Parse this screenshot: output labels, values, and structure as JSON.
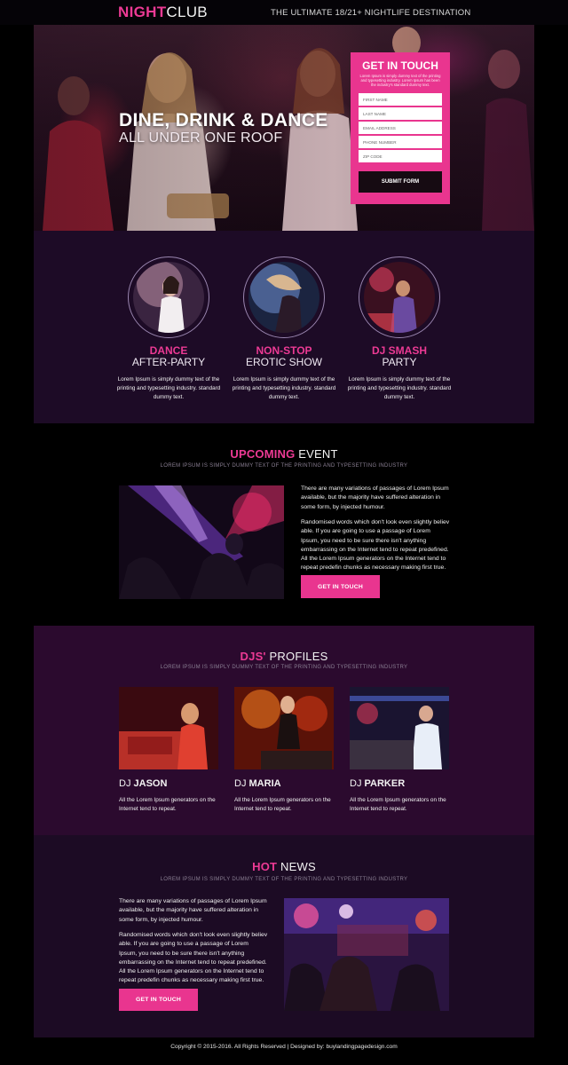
{
  "header": {
    "logo_part1": "NIGHT",
    "logo_part2": "CLUB",
    "tagline": "THE ULTIMATE 18/21+ NIGHTLIFE DESTINATION"
  },
  "hero": {
    "title": "DINE, DRINK & DANCE",
    "subtitle": "ALL UNDER ONE ROOF"
  },
  "form": {
    "title": "GET IN TOUCH",
    "description": "Lorem Ipsum is simply dummy text of the printing and typesetting industry. Lorem Ipsum has been the industry's standard dummy text.",
    "fields": {
      "first_name": "FIRST NAME",
      "last_name": "LAST NAME",
      "email": "EMAIL ADDRESS",
      "phone": "PHONE NUMBER",
      "zip": "ZIP CODE"
    },
    "submit_label": "SUBMIT FORM"
  },
  "features": [
    {
      "title_bold": "DANCE",
      "title_light": "AFTER-PARTY",
      "text": "Lorem Ipsum is simply dummy text of the printing and typesetting industry. standard dummy text."
    },
    {
      "title_bold": "NON-STOP",
      "title_light": "EROTIC SHOW",
      "text": "Lorem Ipsum is simply dummy text of the printing and typesetting industry. standard dummy text."
    },
    {
      "title_bold": "DJ SMASH",
      "title_light": "PARTY",
      "text": "Lorem Ipsum is simply dummy text of the printing and typesetting industry. standard dummy text."
    }
  ],
  "upcoming": {
    "title_highlight": "UPCOMING",
    "title_rest": "EVENT",
    "subtitle": "LOREM IPSUM IS SIMPLY DUMMY TEXT OF THE PRINTING AND TYPESETTING INDUSTRY",
    "para1": "There are many variations of passages of Lorem Ipsum available, but the majority have suffered alteration in some form, by injected humour.",
    "para2": "Randomised words which don't look even slightly believ able. If you are going to use a passage of Lorem Ipsum, you need to be sure there isn't anything embarrassing on the Internet tend to repeat predefined. All the Lorem Ipsum generators on the Internet tend to repeat predefin chunks as necessary making first true.",
    "button_label": "GET IN TOUCH"
  },
  "djs": {
    "title_highlight": "DJS'",
    "title_rest": "PROFILES",
    "subtitle": "LOREM IPSUM IS SIMPLY DUMMY TEXT OF THE PRINTING AND TYPESETTING INDUSTRY",
    "profiles": [
      {
        "prefix": "DJ",
        "name": "JASON",
        "text": "All the Lorem Ipsum generators on the Internet tend to repeat."
      },
      {
        "prefix": "DJ",
        "name": "MARIA",
        "text": "All the Lorem Ipsum generators on the Internet tend to repeat."
      },
      {
        "prefix": "DJ",
        "name": "PARKER",
        "text": "All the Lorem Ipsum generators on the Internet tend to repeat."
      }
    ]
  },
  "news": {
    "title_highlight": "HOT",
    "title_rest": "NEWS",
    "subtitle": "LOREM IPSUM IS SIMPLY DUMMY TEXT OF THE PRINTING AND TYPESETTING INDUSTRY",
    "para1": "There are many variations of passages of Lorem Ipsum available, but the majority have suffered alteration in some form, by injected humour.",
    "para2": "Randomised words which don't look even slightly believ able. If you are going to use a passage of Lorem Ipsum, you need to be sure there isn't anything embarrassing on the Internet tend to repeat predefined. All the Lorem Ipsum generators on the Internet tend to repeat predefin chunks as necessary making first true.",
    "button_label": "GET IN TOUCH"
  },
  "footer": {
    "text": "Copyright © 2015-2016. All Rights Reserved  |  Designed by: buylandingpagedesign.com"
  },
  "colors": {
    "accent": "#e9358f",
    "features_bg": "#1d0b26",
    "djs_bg": "#2b0a2e",
    "news_bg": "#1c0b24",
    "page_bg": "#000000"
  }
}
